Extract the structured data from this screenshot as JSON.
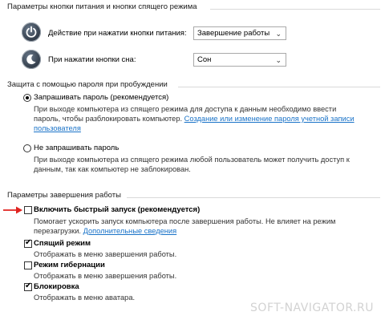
{
  "power_buttons": {
    "title": "Параметры кнопки питания и кнопки спящего режима",
    "power_label": "Действие при нажатии кнопки питания:",
    "power_value": "Завершение работы",
    "sleep_label": "При нажатии кнопки сна:",
    "sleep_value": "Сон"
  },
  "password": {
    "title": "Защита с помощью пароля при пробуждении",
    "require_label": "Запрашивать пароль (рекомендуется)",
    "require_desc_1": "При выходе компьютера из спящего режима для доступа к данным необходимо ввести",
    "require_desc_2": "пароль, чтобы разблокировать компьютер. ",
    "require_link_1": "Создание или изменение пароля учетной записи",
    "require_link_2": "пользователя",
    "no_require_label": "Не запрашивать пароль",
    "no_require_desc_1": "При выходе компьютера из спящего режима любой пользователь может получить доступ к",
    "no_require_desc_2": "данным, так как компьютер не заблокирован.",
    "selected": "require"
  },
  "shutdown": {
    "title": "Параметры завершения работы",
    "fast_startup_label": "Включить быстрый запуск (рекомендуется)",
    "fast_startup_desc_1": "Помогает ускорить запуск компьютера после завершения работы. Не влияет на режим",
    "fast_startup_desc_2": "перезагрузки. ",
    "fast_startup_link": "Дополнительные сведения",
    "fast_startup_checked": false,
    "sleep_label": "Спящий режим",
    "sleep_desc": "Отображать в меню завершения работы.",
    "sleep_checked": true,
    "hibernate_label": "Режим гибернации",
    "hibernate_desc": "Отображать в меню завершения работы.",
    "hibernate_checked": false,
    "lock_label": "Блокировка",
    "lock_desc": "Отображать в меню аватара.",
    "lock_checked": true
  },
  "colors": {
    "link": "#1a73c8",
    "arrow": "#e0231f"
  },
  "icons": {
    "power": "power-button-icon",
    "sleep": "moon-icon",
    "dropdown": "chevron-down-icon",
    "pointer": "red-arrow-icon"
  },
  "watermark": "SOFT-NAVIGATOR.RU"
}
